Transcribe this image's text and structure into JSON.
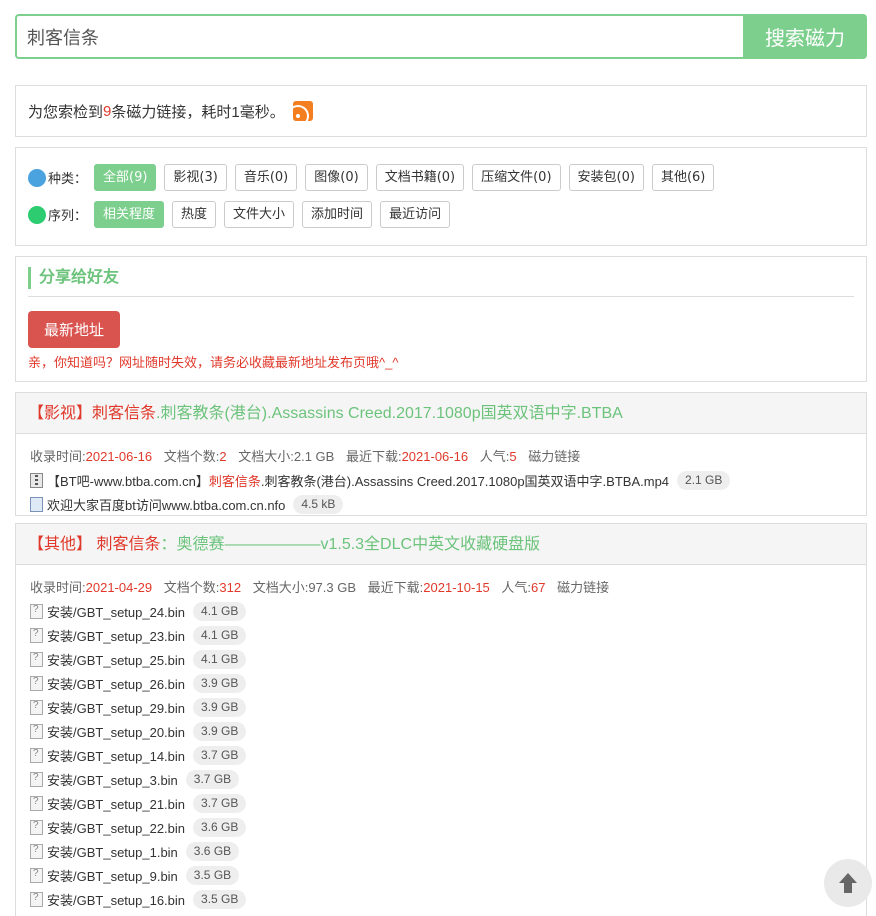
{
  "search": {
    "value": "刺客信条",
    "button": "搜索磁力"
  },
  "summary": {
    "prefix": "为您索检到",
    "count": "9",
    "suffix": "条磁力链接，耗时1毫秒。"
  },
  "filters": {
    "type_label": "种类：",
    "types": [
      "全部(9)",
      "影视(3)",
      "音乐(0)",
      "图像(0)",
      "文档书籍(0)",
      "压缩文件(0)",
      "安装包(0)",
      "其他(6)"
    ],
    "sort_label": "序列：",
    "sorts": [
      "相关程度",
      "热度",
      "文件大小",
      "添加时间",
      "最近访问"
    ]
  },
  "share": {
    "title": "分享给好友",
    "button": "最新地址",
    "note": "亲，你知道吗？网址随时失效，请务必收藏最新地址发布页哦^_^"
  },
  "results": [
    {
      "category": "【影视】",
      "keyword": "刺客信条",
      "title": ".刺客教条(港台).Assassins Creed.2017.1080p国英双语中字.BTBA",
      "meta": {
        "collected_label": "收录时间:",
        "collected": "2021-06-16",
        "count_label": "文档个数:",
        "count": "2",
        "size_label": "文档大小:",
        "size": "2.1 GB",
        "download_label": "最近下载:",
        "download": "2021-06-16",
        "pop_label": "人气:",
        "pop": "5",
        "link": "磁力链接"
      },
      "files": [
        {
          "pre": "【BT吧-www.btba.com.cn】",
          "kw": "刺客信条",
          "post": ".刺客教条(港台).Assassins Creed.2017.1080p国英双语中字.BTBA.mp4",
          "size": "2.1 GB",
          "icon": "zip-file-icon"
        },
        {
          "pre": "欢迎大家百度bt访问www.btba.com.cn.nfo",
          "kw": "",
          "post": "",
          "size": "4.5 kB",
          "icon": "info-file-icon"
        }
      ]
    },
    {
      "category": "【其他】",
      "keyword": " 刺客信条",
      "title": "：奥德赛——————v1.5.3全DLC中英文收藏硬盘版",
      "meta": {
        "collected_label": "收录时间:",
        "collected": "2021-04-29",
        "count_label": "文档个数:",
        "count": "312",
        "size_label": "文档大小:",
        "size": "97.3 GB",
        "download_label": "最近下载:",
        "download": "2021-10-15",
        "pop_label": "人气:",
        "pop": "67",
        "link": "磁力链接"
      },
      "files": [
        {
          "pre": "安装/GBT_setup_24.bin",
          "size": "4.1 GB"
        },
        {
          "pre": "安装/GBT_setup_23.bin",
          "size": "4.1 GB"
        },
        {
          "pre": "安装/GBT_setup_25.bin",
          "size": "4.1 GB"
        },
        {
          "pre": "安装/GBT_setup_26.bin",
          "size": "3.9 GB"
        },
        {
          "pre": "安装/GBT_setup_29.bin",
          "size": "3.9 GB"
        },
        {
          "pre": "安装/GBT_setup_20.bin",
          "size": "3.9 GB"
        },
        {
          "pre": "安装/GBT_setup_14.bin",
          "size": "3.7 GB"
        },
        {
          "pre": "安装/GBT_setup_3.bin",
          "size": "3.7 GB"
        },
        {
          "pre": "安装/GBT_setup_21.bin",
          "size": "3.7 GB"
        },
        {
          "pre": "安装/GBT_setup_22.bin",
          "size": "3.6 GB"
        },
        {
          "pre": "安装/GBT_setup_1.bin",
          "size": "3.6 GB"
        },
        {
          "pre": "安装/GBT_setup_9.bin",
          "size": "3.5 GB"
        },
        {
          "pre": "安装/GBT_setup_16.bin",
          "size": "3.5 GB"
        }
      ]
    }
  ]
}
